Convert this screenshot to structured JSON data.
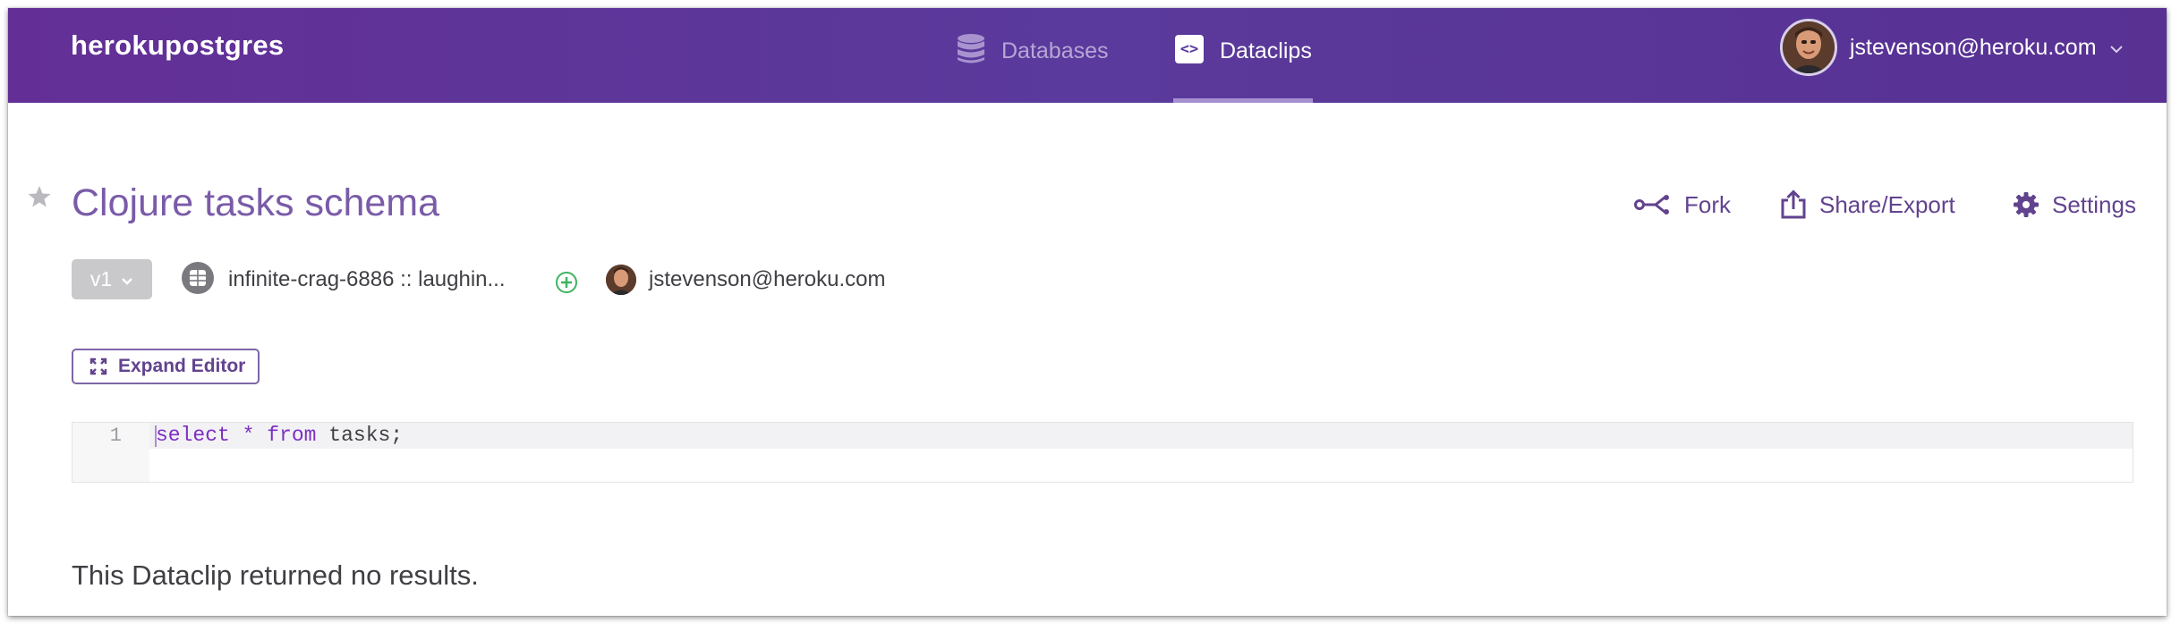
{
  "header": {
    "brand": "herokupostgres",
    "nav": [
      {
        "label": "Databases",
        "icon": "database-icon"
      },
      {
        "label": "Dataclips",
        "icon": "code-brackets-icon",
        "icon_text": "<>",
        "active": true
      }
    ],
    "user": {
      "email": "jstevenson@heroku.com",
      "avatar": "user-avatar"
    }
  },
  "dataclip": {
    "title": "Clojure tasks schema",
    "starred": false,
    "actions": {
      "fork": "Fork",
      "share": "Share/Export",
      "settings": "Settings"
    },
    "version": "v1",
    "database": "infinite-crag-6886 :: laughin...",
    "owner_email": "jstevenson@heroku.com",
    "expand_editor": "Expand Editor",
    "editor": {
      "line_number": "1",
      "tokens": {
        "select": "select",
        "star": "*",
        "from": "from",
        "rest": "tasks;"
      }
    },
    "result_message": "This Dataclip returned no results."
  },
  "colors": {
    "header_gradient": [
      "#632f96",
      "#5a3a9c",
      "#583193"
    ],
    "title": "#7a5ba8",
    "action": "#62438f",
    "keyword": "#7d2fc2",
    "add_green": "#3db35e"
  }
}
